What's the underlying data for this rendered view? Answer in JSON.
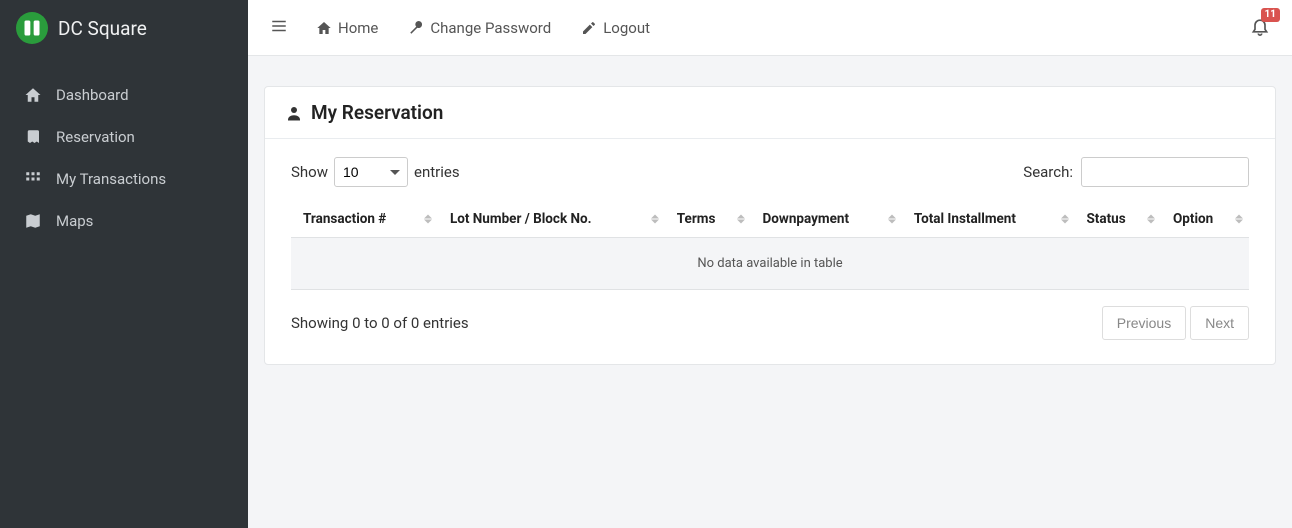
{
  "brand": {
    "title": "DC Square"
  },
  "sidebar": {
    "items": [
      {
        "label": "Dashboard"
      },
      {
        "label": "Reservation"
      },
      {
        "label": "My Transactions"
      },
      {
        "label": "Maps"
      }
    ]
  },
  "topnav": {
    "home": "Home",
    "change_password": "Change Password",
    "logout": "Logout",
    "notifications_count": "11"
  },
  "page": {
    "title": "My Reservation"
  },
  "datatable": {
    "show_label_before": "Show",
    "show_label_after": "entries",
    "page_size": "10",
    "search_label": "Search:",
    "search_value": "",
    "columns": [
      "Transaction #",
      "Lot Number / Block No.",
      "Terms",
      "Downpayment",
      "Total Installment",
      "Status",
      "Option"
    ],
    "empty_text": "No data available in table",
    "info_text": "Showing 0 to 0 of 0 entries",
    "prev_label": "Previous",
    "next_label": "Next"
  }
}
